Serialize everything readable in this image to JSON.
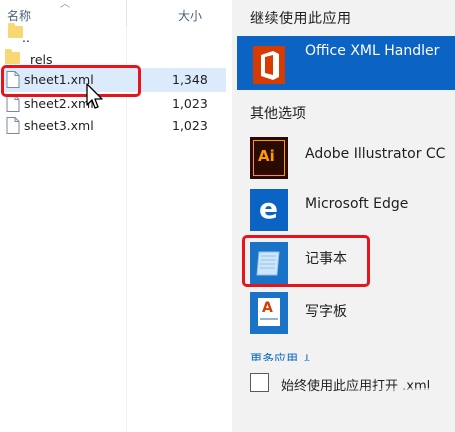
{
  "explorer": {
    "columns": {
      "name": "名称",
      "size": "大小"
    },
    "rows": [
      {
        "name": "..",
        "size": "",
        "type": "folder",
        "icon": "folder-icon"
      },
      {
        "name": "rels",
        "size": "",
        "type": "folder",
        "icon": "folder-icon"
      },
      {
        "name": "sheet1.xml",
        "size": "1,348",
        "type": "file",
        "icon": "xml-file-icon",
        "selected": true
      },
      {
        "name": "sheet2.xml",
        "size": "1,023",
        "type": "file",
        "icon": "xml-file-icon"
      },
      {
        "name": "sheet3.xml",
        "size": "1,023",
        "type": "file",
        "icon": "xml-file-icon"
      }
    ]
  },
  "open_with": {
    "title": "继续使用此应用",
    "selected_app": {
      "label": "Office XML Handler",
      "icon": "office-icon"
    },
    "other_options_title": "其他选项",
    "apps": [
      {
        "label": "Adobe Illustrator CC",
        "icon": "illustrator-icon",
        "tile_text": "Ai"
      },
      {
        "label": "Microsoft Edge",
        "icon": "edge-icon",
        "tile_text": "e"
      },
      {
        "label": "记事本",
        "icon": "notepad-icon"
      },
      {
        "label": "写字板",
        "icon": "wordpad-icon",
        "tile_text": "A"
      }
    ],
    "more_apps": "更多应用 ↓",
    "always_use_label": "始终使用此应用打开 .xml"
  },
  "colors": {
    "highlight": "#e8141c",
    "selected_app_bg": "#0b63c4",
    "selection_row": "#dcebfc",
    "link": "#0067c0"
  }
}
